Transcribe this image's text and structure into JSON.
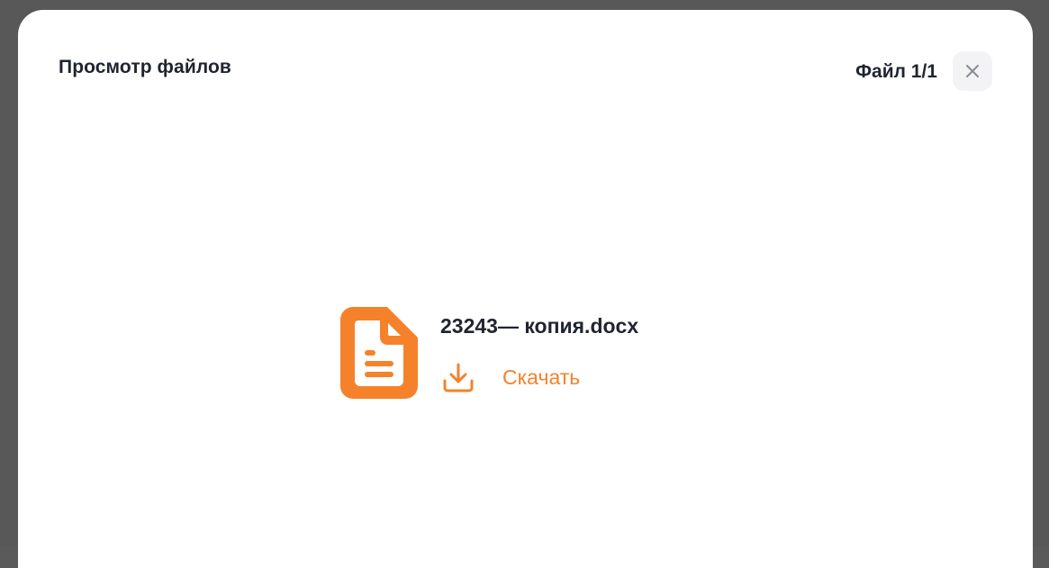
{
  "modal": {
    "title": "Просмотр файлов",
    "file_counter": "Файл 1/1",
    "close_icon": "close-icon"
  },
  "file": {
    "name": "23243— копия.docx",
    "icon": "document-icon",
    "download_label": "Скачать",
    "download_icon": "download-icon"
  },
  "colors": {
    "accent": "#f5822a",
    "text": "#1f2430",
    "backdrop": "#585858",
    "close_bg": "#f3f3f5"
  }
}
